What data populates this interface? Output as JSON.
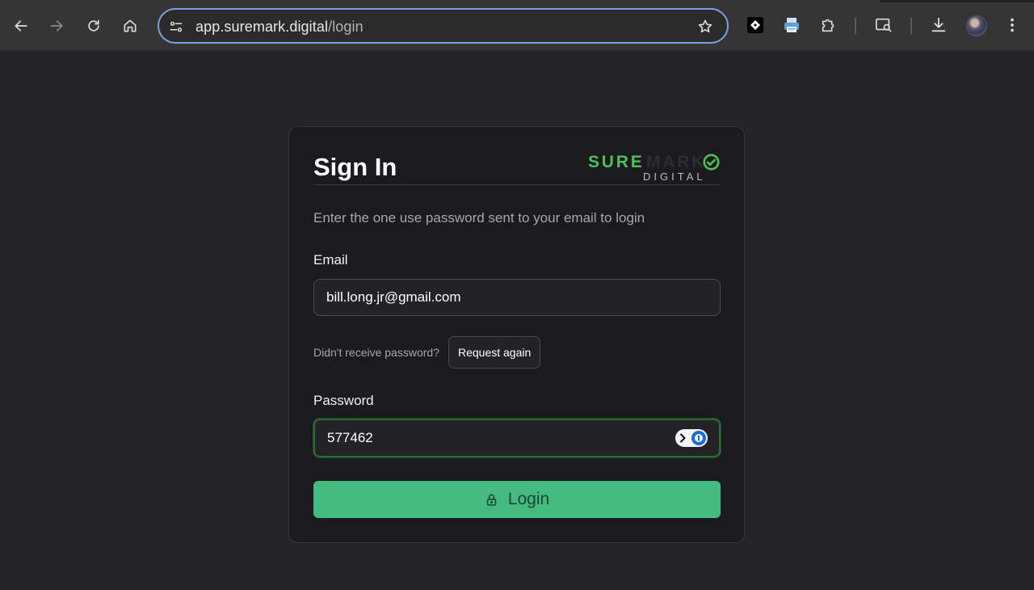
{
  "browser": {
    "url_host": "app.suremark.digital",
    "url_path": "/login",
    "icons": [
      "back-icon",
      "forward-icon",
      "reload-icon",
      "home-icon",
      "site-settings-icon",
      "bookmark-star-icon",
      "extension-icon",
      "printer-extension-icon",
      "puzzle-icon",
      "tab-search-icon",
      "download-icon",
      "profile-avatar",
      "more-menu-icon"
    ]
  },
  "card": {
    "title": "Sign In",
    "logo": {
      "part1": "SURE",
      "part2": "MARK",
      "sub": "DIGITAL",
      "accent": "#4fbf5b"
    },
    "subtitle": "Enter the one use password sent to your email to login",
    "email": {
      "label": "Email",
      "value": "bill.long.jr@gmail.com"
    },
    "resend": {
      "hint": "Didn't receive password?",
      "button": "Request again"
    },
    "password": {
      "label": "Password",
      "value": "577462"
    },
    "login_button": {
      "label": "Login",
      "color": "#44ba80"
    }
  }
}
